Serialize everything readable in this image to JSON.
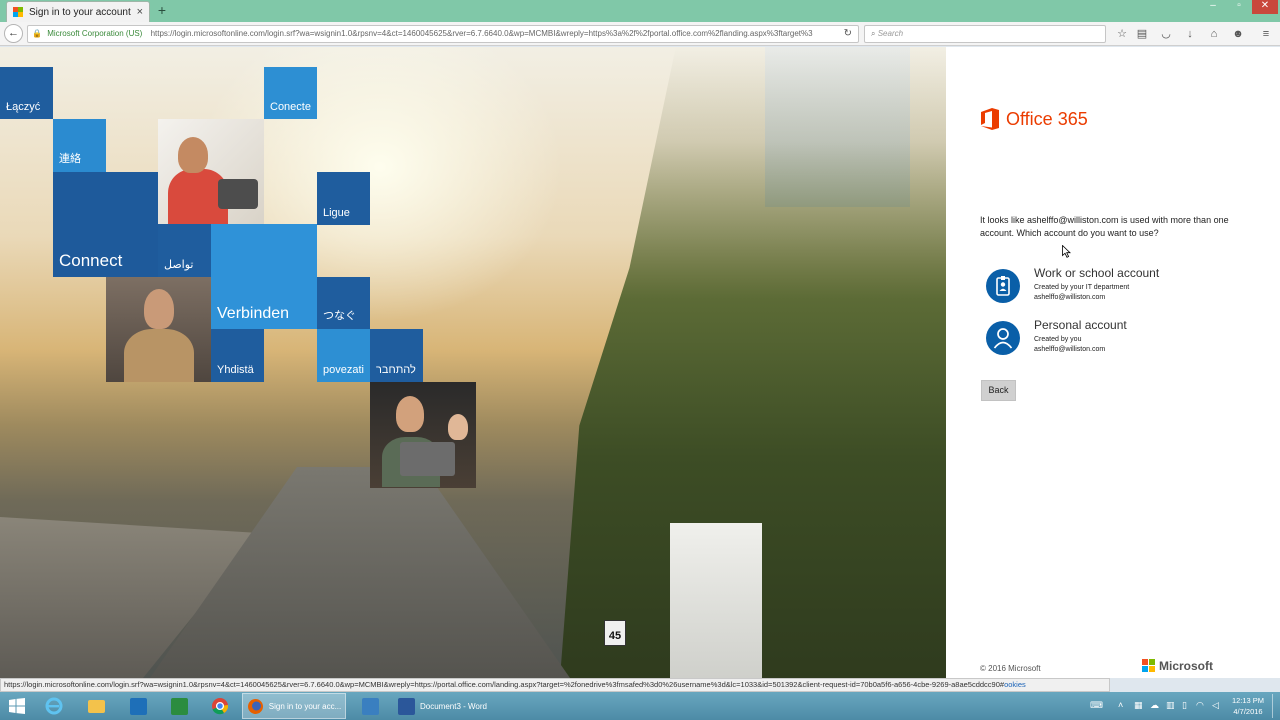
{
  "browser": {
    "tab_title": "Sign in to your account",
    "tab_close": "×",
    "new_tab": "+",
    "identity": "Microsoft Corporation (US)",
    "url": "https://login.microsoftonline.com/login.srf?wa=wsignin1.0&rpsnv=4&ct=1460045625&rver=6.7.6640.0&wp=MCMBI&wreply=https%3a%2f%2fportal.office.com%2flanding.aspx%3ftarget%3",
    "search_placeholder": "Search"
  },
  "tiles": {
    "laczyc": "Łączyć",
    "conecte": "Conecte",
    "renraku": "連絡",
    "ligue": "Ligue",
    "connect": "Connect",
    "arabic": "تواصل",
    "verbinden": "Verbinden",
    "tsunagu": "つなぐ",
    "yhdista": "Yhdistä",
    "povezati": "povezati",
    "hebrew": "להתחבר"
  },
  "signin": {
    "brand": "Office 365",
    "prompt": "It looks like ashelffo@williston.com is used with more than one account. Which account do you want to use?",
    "accounts": [
      {
        "name": "Work or school account",
        "sub": "Created by your IT department",
        "email": "ashelffo@williston.com",
        "icon": "work-badge-icon"
      },
      {
        "name": "Personal account",
        "sub": "Created by you",
        "email": "ashelffo@williston.com",
        "icon": "person-icon"
      }
    ],
    "back": "Back",
    "copyright": "© 2016 Microsoft",
    "footer_brand": "Microsoft"
  },
  "status": {
    "link": "https://login.microsoftonline.com/login.srf?wa=wsignin1.0&rpsnv=4&ct=1460045625&rver=6.7.6640.0&wp=MCMBI&wreply=https://portal.office.com/landing.aspx?target=%2fonedrive%3fmsafed%3d0%26username%3d&lc=1033&id=501392&client-request-id=70b0a5f6-a656-4cbe-9269-a8ae5cddcc90#",
    "tail": "ookies"
  },
  "taskbar": {
    "firefox_label": "Sign in to your acc...",
    "word_label": "Document3 - Word",
    "time": "12:13 PM",
    "date": "4/7/2016"
  },
  "colors": {
    "office_orange": "#eb3c00",
    "account_blue": "#0a5fa8",
    "tile_dark": "#1d5a9c",
    "tile_light": "#2f8fd6"
  }
}
